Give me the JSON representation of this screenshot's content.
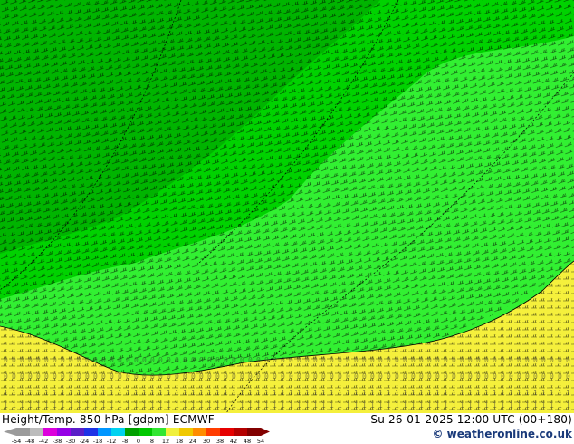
{
  "map": {
    "product": "Height/Temp. 850 hPa [gdpm] ECMWF",
    "valid_time": "Su 26-01-2025 12:00 UTC (00+180)",
    "credit": "© weatheronline.co.uk",
    "colors": {
      "zone_deep": "#00b400",
      "zone_mid": "#00d200",
      "zone_light": "#32f032",
      "zone_warm": "#f5f03c",
      "contour": "#000000",
      "wind_barb": "#000000",
      "graticule": "#000000"
    },
    "field_labels": [
      "0",
      "1"
    ]
  },
  "legend": {
    "ticks": [
      "-54",
      "-48",
      "-42",
      "-38",
      "-30",
      "-24",
      "-18",
      "-12",
      "-8",
      "0",
      "8",
      "12",
      "18",
      "24",
      "30",
      "38",
      "42",
      "48",
      "54"
    ],
    "colors": [
      "#9b9b9b",
      "#bcbcbc",
      "#dc00dc",
      "#9600e6",
      "#5a1ec8",
      "#1e32e6",
      "#0096ff",
      "#00d2f0",
      "#00a000",
      "#00c800",
      "#32e632",
      "#f0f03c",
      "#f0c800",
      "#ff8c00",
      "#ff3c00",
      "#e60000",
      "#b40000",
      "#820000"
    ]
  }
}
